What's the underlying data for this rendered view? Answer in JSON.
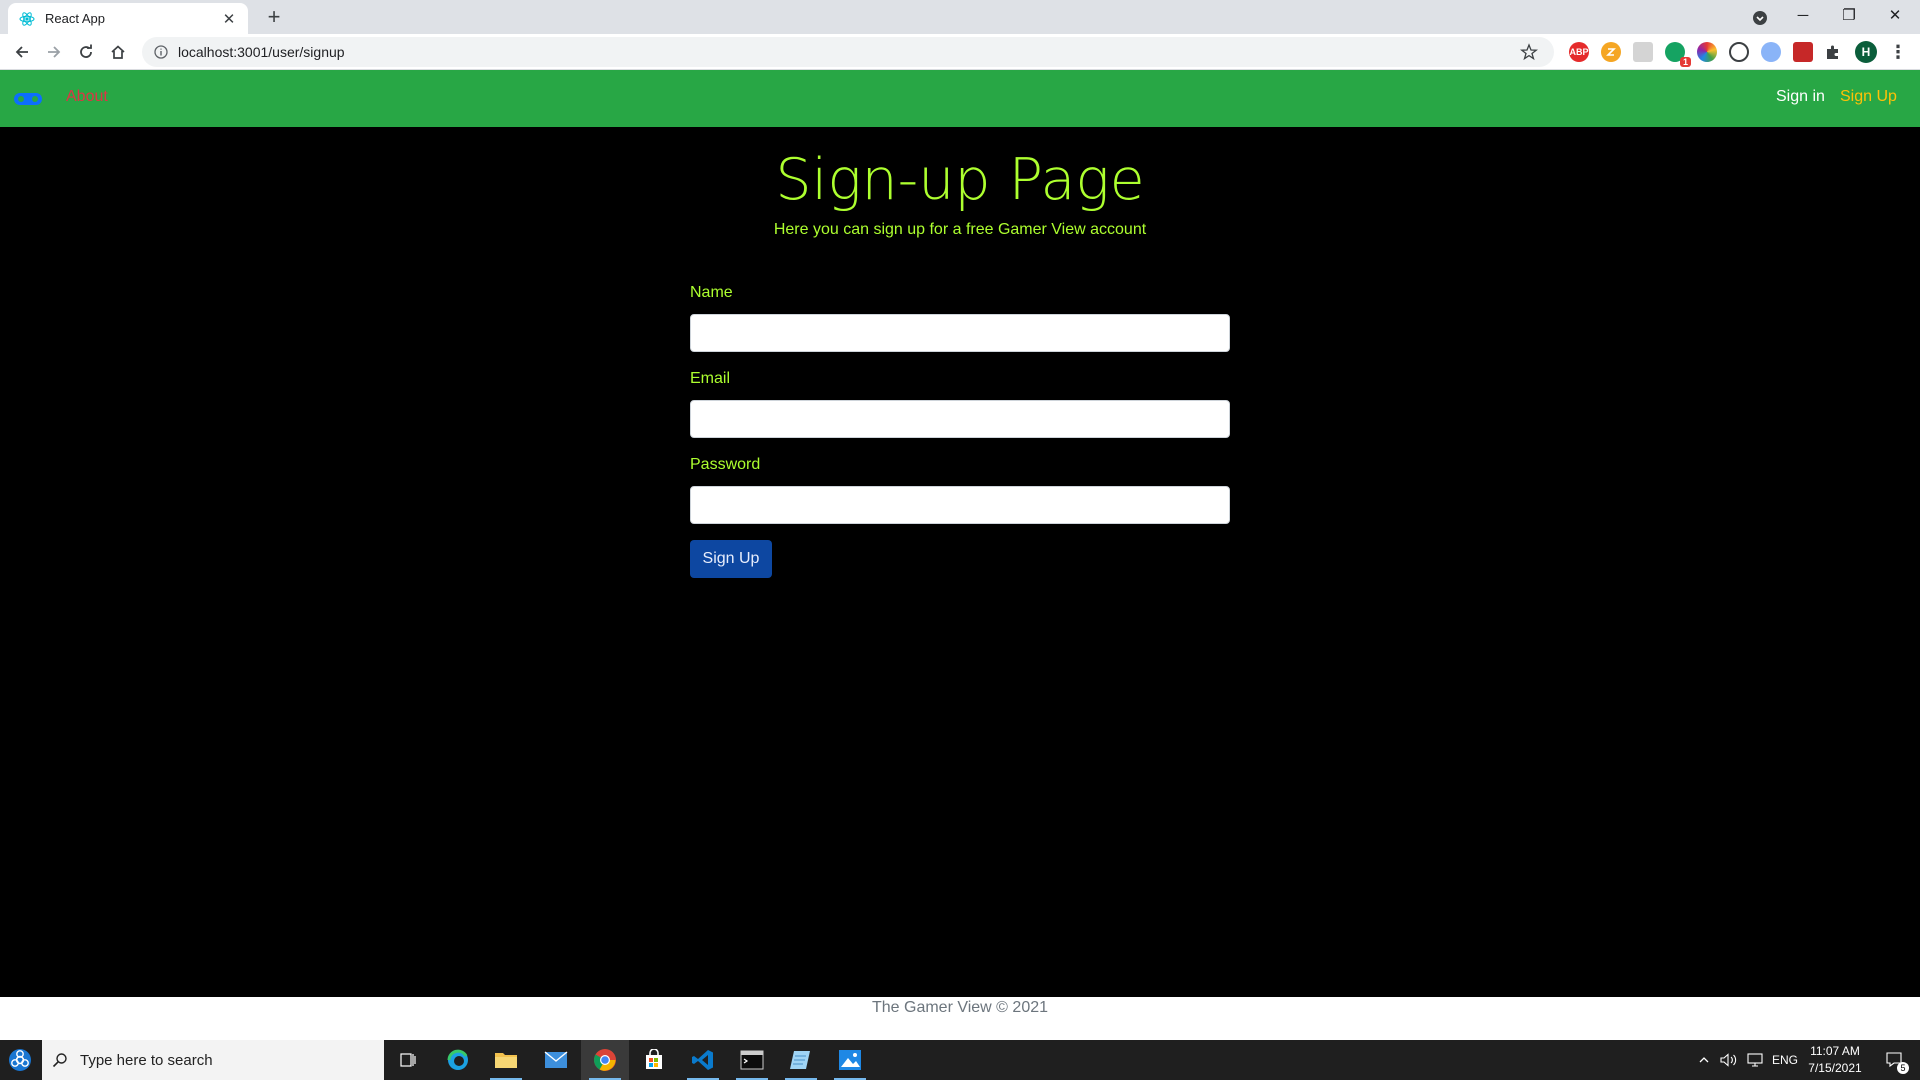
{
  "browser": {
    "tab_title": "React App",
    "tab_close": "✕",
    "new_tab": "+",
    "url": "localhost:3001/user/signup",
    "profile_initial": "H",
    "ext_abp": "ABP",
    "ext_badge_count": "1",
    "window_controls": {
      "minimize": "─",
      "restore": "❐",
      "close": "✕"
    }
  },
  "navbar": {
    "about": "About",
    "signin": "Sign in",
    "signup": "Sign Up",
    "colors": {
      "bg": "#28a745",
      "about": "#dc3545",
      "signup": "#ffc107"
    }
  },
  "page": {
    "heading": "Sign-up Page",
    "lead": "Here you can sign up for a free Gamer View account",
    "accent_color": "#adff2f",
    "form": {
      "name_label": "Name",
      "name_value": "",
      "email_label": "Email",
      "email_value": "",
      "password_label": "Password",
      "password_value": "",
      "submit": "Sign Up"
    }
  },
  "footer": {
    "text": "The Gamer View © 2021"
  },
  "taskbar": {
    "search_placeholder": "Type here to search",
    "language": "ENG",
    "time": "11:07 AM",
    "date": "7/15/2021",
    "notification_count": "5"
  }
}
